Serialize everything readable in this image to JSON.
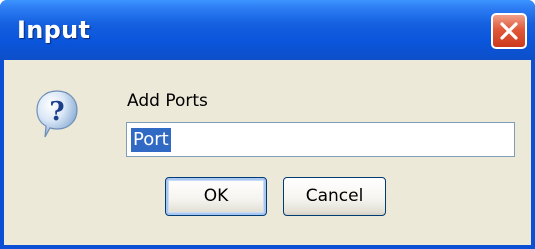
{
  "window": {
    "title": "Input",
    "close_icon": "close-x-icon"
  },
  "dialog": {
    "icon": "question-icon",
    "prompt": "Add Ports",
    "input_value": "Port",
    "input_selected": true
  },
  "buttons": {
    "ok_label": "OK",
    "cancel_label": "Cancel"
  },
  "colors": {
    "titlebar": "#0a55db",
    "dialog_background": "#ece9d8",
    "selection": "#316ac5",
    "close_button": "#e0593a"
  }
}
